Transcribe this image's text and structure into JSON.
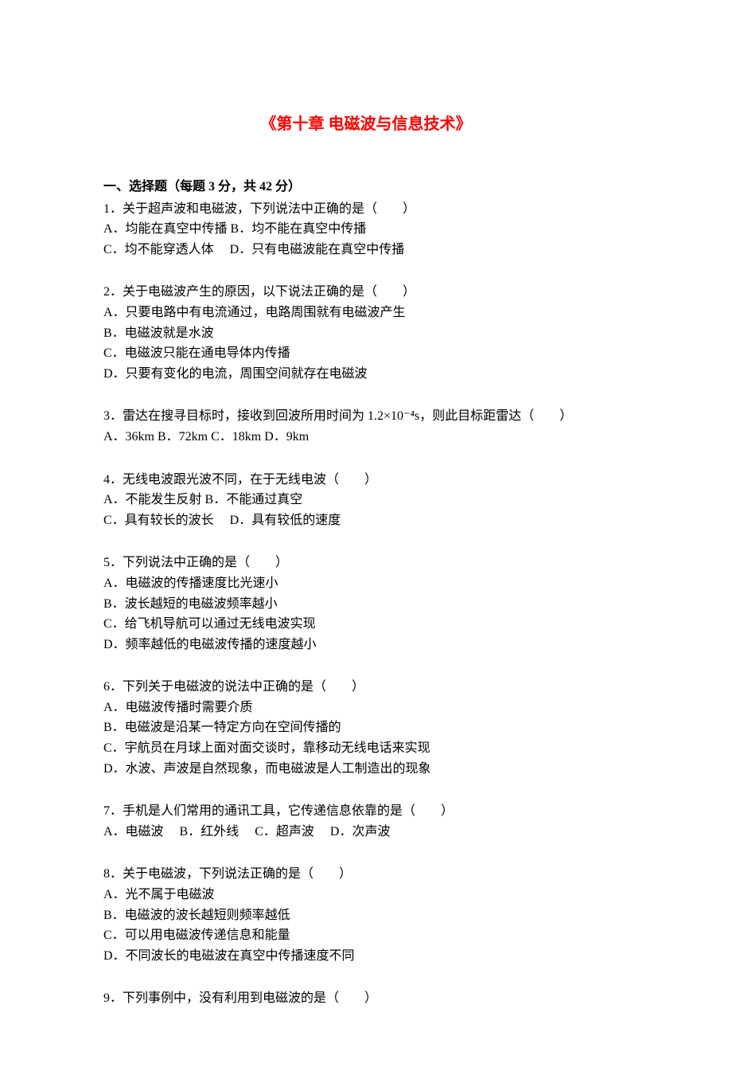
{
  "title": "《第十章 电磁波与信息技术》",
  "section_header": "一、选择题（每题 3 分，共 42 分）",
  "questions": [
    {
      "stem": "1．关于超声波和电磁波，下列说法中正确的是（　　）",
      "option_lines": [
        "A．均能在真空中传播 B．均不能在真空中传播",
        "C．均不能穿透人体　 D．只有电磁波能在真空中传播"
      ]
    },
    {
      "stem": "2．关于电磁波产生的原因，以下说法正确的是（　　）",
      "option_lines": [
        "A．只要电路中有电流通过，电路周围就有电磁波产生",
        "B．电磁波就是水波",
        "C．电磁波只能在通电导体内传播",
        "D．只要有变化的电流，周围空间就存在电磁波"
      ]
    },
    {
      "stem": "3．雷达在搜寻目标时，接收到回波所用时间为 1.2×10⁻⁴s，则此目标距雷达（　　）",
      "option_lines": [
        "A．36km B．72km C．18km D．9km"
      ]
    },
    {
      "stem": "4．无线电波跟光波不同，在于无线电波（　　）",
      "option_lines": [
        "A．不能发生反射 B．不能通过真空",
        "C．具有较长的波长　 D．具有较低的速度"
      ]
    },
    {
      "stem": "5．下列说法中正确的是（　　）",
      "option_lines": [
        "A．电磁波的传播速度比光速小",
        "B．波长越短的电磁波频率越小",
        "C．给飞机导航可以通过无线电波实现",
        "D．频率越低的电磁波传播的速度越小"
      ]
    },
    {
      "stem": "6．下列关于电磁波的说法中正确的是（　　）",
      "option_lines": [
        "A．电磁波传播时需要介质",
        "B．电磁波是沿某一特定方向在空间传播的",
        "C．宇航员在月球上面对面交谈时，靠移动无线电话来实现",
        "D．水波、声波是自然现象，而电磁波是人工制造出的现象"
      ]
    },
    {
      "stem": "7．手机是人们常用的通讯工具，它传递信息依靠的是（　　）",
      "option_lines": [
        "A．电磁波　 B．红外线　 C．超声波　 D．次声波"
      ]
    },
    {
      "stem": "8．关于电磁波，下列说法正确的是（　　）",
      "option_lines": [
        "A．光不属于电磁波",
        "B．电磁波的波长越短则频率越低",
        "C．可以用电磁波传递信息和能量",
        "D．不同波长的电磁波在真空中传播速度不同"
      ]
    },
    {
      "stem": "9．下列事例中，没有利用到电磁波的是（　　）",
      "option_lines": []
    }
  ]
}
